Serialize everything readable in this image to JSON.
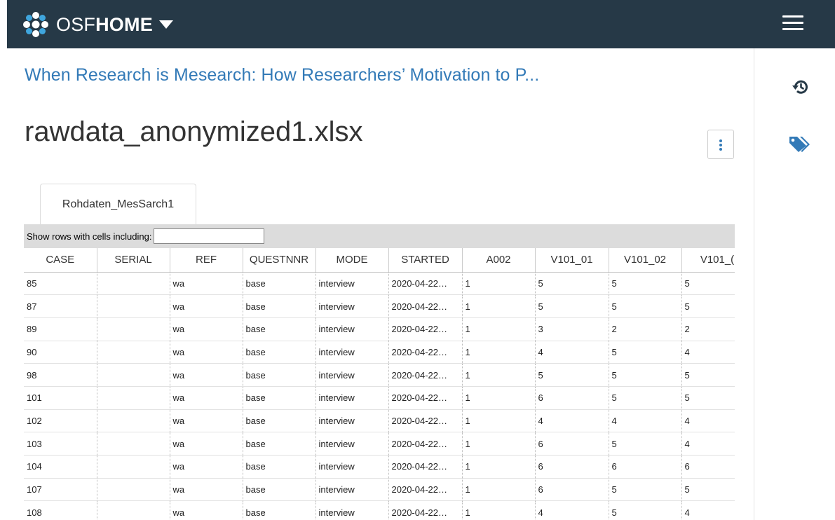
{
  "navbar": {
    "brand_osf": "OSF",
    "brand_home": "HOME"
  },
  "project": {
    "title": "When Research is Mesearch: How Researchers’ Motivation to P..."
  },
  "file": {
    "name": "rawdata_anonymized1.xlsx"
  },
  "sheet": {
    "tab_label": "Rohdaten_MesSarch1",
    "filter_label": "Show rows with cells including:",
    "filter_value": "",
    "columns": [
      "CASE",
      "SERIAL",
      "REF",
      "QUESTNNR",
      "MODE",
      "STARTED",
      "A002",
      "V101_01",
      "V101_02",
      "V101_("
    ],
    "rows": [
      [
        "85",
        "",
        "wa",
        "base",
        "interview",
        "2020-04-22…",
        "1",
        "5",
        "5",
        "5"
      ],
      [
        "87",
        "",
        "wa",
        "base",
        "interview",
        "2020-04-22…",
        "1",
        "5",
        "5",
        "5"
      ],
      [
        "89",
        "",
        "wa",
        "base",
        "interview",
        "2020-04-22…",
        "1",
        "3",
        "2",
        "2"
      ],
      [
        "90",
        "",
        "wa",
        "base",
        "interview",
        "2020-04-22…",
        "1",
        "4",
        "5",
        "4"
      ],
      [
        "98",
        "",
        "wa",
        "base",
        "interview",
        "2020-04-22…",
        "1",
        "5",
        "5",
        "5"
      ],
      [
        "101",
        "",
        "wa",
        "base",
        "interview",
        "2020-04-22…",
        "1",
        "6",
        "5",
        "5"
      ],
      [
        "102",
        "",
        "wa",
        "base",
        "interview",
        "2020-04-22…",
        "1",
        "4",
        "4",
        "4"
      ],
      [
        "103",
        "",
        "wa",
        "base",
        "interview",
        "2020-04-22…",
        "1",
        "6",
        "5",
        "4"
      ],
      [
        "104",
        "",
        "wa",
        "base",
        "interview",
        "2020-04-22…",
        "1",
        "6",
        "6",
        "6"
      ],
      [
        "107",
        "",
        "wa",
        "base",
        "interview",
        "2020-04-22…",
        "1",
        "6",
        "5",
        "5"
      ],
      [
        "108",
        "",
        "wa",
        "base",
        "interview",
        "2020-04-22…",
        "1",
        "4",
        "5",
        "4"
      ]
    ]
  },
  "icons": {
    "logo": "osf-logo-icon",
    "menu": "hamburger-menu-icon",
    "history": "history-icon",
    "tags": "tags-icon",
    "more": "vertical-ellipsis-icon"
  },
  "colors": {
    "navbar": "#263947",
    "link": "#337ab7",
    "logo_blue": "#3fa6de"
  }
}
